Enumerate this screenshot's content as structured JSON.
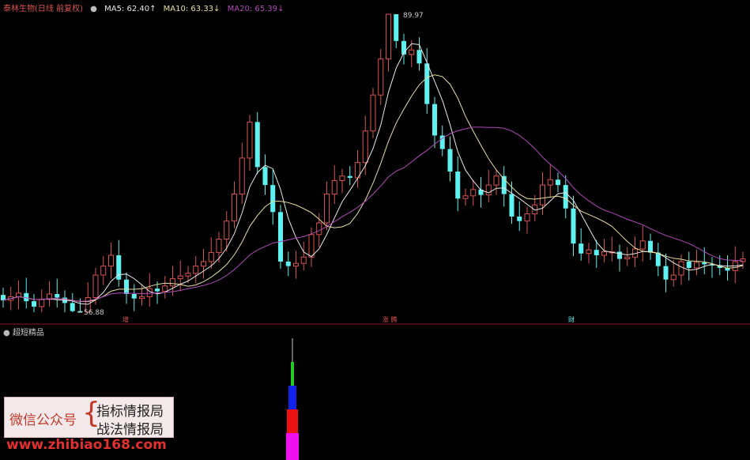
{
  "header": {
    "stock_title": "泰林生物(日线 前复权)",
    "ma5": "MA5: 62.40↑",
    "ma10": "MA10: 63.33↓",
    "ma20": "MA20: 65.39↓"
  },
  "colors": {
    "up": "#d9534f",
    "down": "#5ff0f0",
    "ma5": "#e8e8e8",
    "ma10": "#e8e0a0",
    "ma20": "#b04ab8",
    "divider": "#8b1a1a"
  },
  "markers": {
    "high": "89.97",
    "low": "56.88"
  },
  "date_labels": [
    "增",
    "涨 腾",
    "财"
  ],
  "indicator": {
    "title": "超短精品"
  },
  "watermark": {
    "left": "微信公众号",
    "right_line1": "指标情报局",
    "right_line2": "战法情报局",
    "url": "www.zhibiao168.com"
  },
  "chart_data": {
    "type": "candlestick",
    "ylim": [
      56.88,
      89.97
    ],
    "close": [
      58.2,
      58.6,
      59.0,
      58.1,
      57.5,
      58.3,
      58.9,
      58.5,
      57.9,
      57.0,
      56.88,
      58.5,
      61.0,
      62.0,
      63.2,
      60.5,
      58.9,
      58.4,
      58.6,
      59.5,
      59.2,
      59.8,
      60.6,
      60.9,
      61.2,
      62.0,
      62.5,
      63.5,
      65.0,
      67.0,
      70.0,
      74.0,
      78.0,
      73.0,
      71.0,
      68.0,
      62.5,
      62.0,
      62.3,
      63.0,
      65.5,
      66.8,
      70.0,
      71.5,
      72.0,
      71.8,
      73.5,
      77.0,
      81.0,
      85.0,
      89.97,
      87.0,
      85.5,
      86.0,
      84.5,
      80.0,
      76.5,
      75.0,
      72.5,
      69.5,
      69.8,
      70.5,
      69.9,
      71.0,
      72.0,
      70.0,
      67.5,
      67.0,
      67.8,
      68.8,
      71.0,
      71.6,
      71.0,
      68.4,
      64.5,
      63.4,
      63.8,
      63.2,
      63.6,
      63.6,
      62.8,
      63.0,
      63.9,
      64.8,
      63.5,
      62.0,
      60.5,
      61.0,
      62.5,
      61.8,
      62.4,
      62.2,
      62.1,
      61.8,
      61.5,
      62.5,
      62.8
    ]
  }
}
